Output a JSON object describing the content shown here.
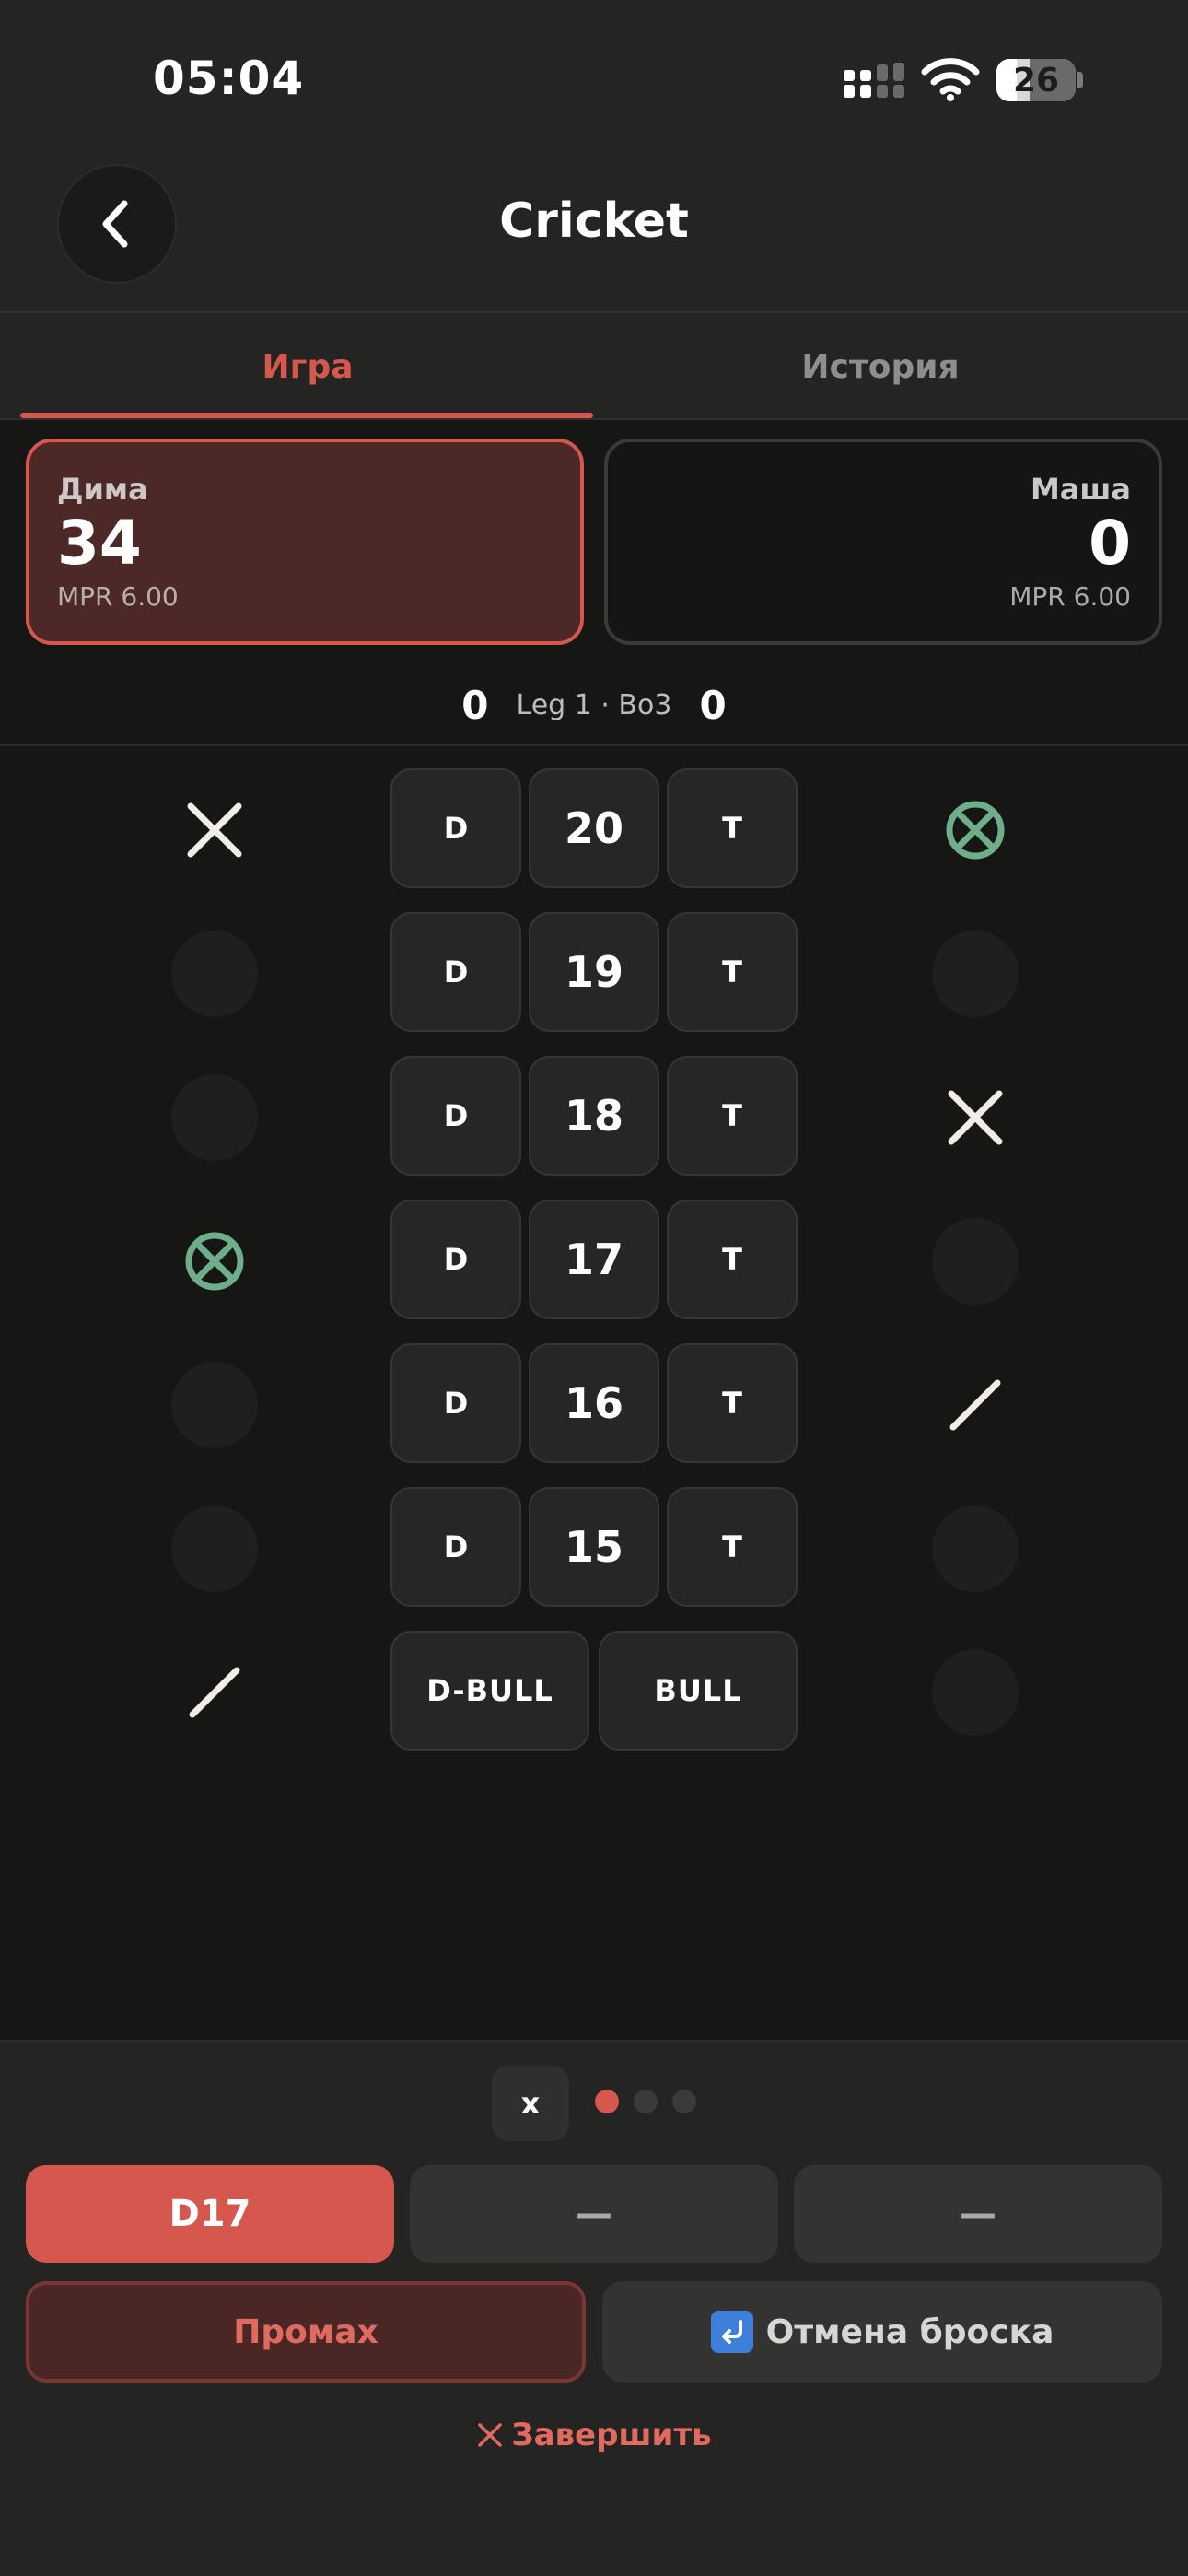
{
  "status_bar": {
    "time": "05:04",
    "battery": "26",
    "battery_level": 0.26
  },
  "header": {
    "title": "Cricket"
  },
  "tabs": [
    {
      "label": "Игра",
      "active": true
    },
    {
      "label": "История",
      "active": false
    }
  ],
  "players": [
    {
      "name": "Дима",
      "score": "34",
      "mpr": "MPR 6.00",
      "active": true
    },
    {
      "name": "Маша",
      "score": "0",
      "mpr": "MPR 6.00",
      "active": false
    }
  ],
  "leg": {
    "left_score": "0",
    "text": "Leg 1 · Bo3",
    "right_score": "0"
  },
  "board": {
    "rows": [
      {
        "double": "D",
        "number": "20",
        "triple": "T",
        "left_marks": 2,
        "right_marks": 3
      },
      {
        "double": "D",
        "number": "19",
        "triple": "T",
        "left_marks": 0,
        "right_marks": 0
      },
      {
        "double": "D",
        "number": "18",
        "triple": "T",
        "left_marks": 0,
        "right_marks": 2
      },
      {
        "double": "D",
        "number": "17",
        "triple": "T",
        "left_marks": 3,
        "right_marks": 0
      },
      {
        "double": "D",
        "number": "16",
        "triple": "T",
        "left_marks": 0,
        "right_marks": 1
      },
      {
        "double": "D",
        "number": "15",
        "triple": "T",
        "left_marks": 0,
        "right_marks": 0
      }
    ],
    "bull_row": {
      "double_bull": "D-BULL",
      "bull": "BULL",
      "left_marks": 1,
      "right_marks": 0
    }
  },
  "input": {
    "multiplier_label": "x",
    "page_dots": 3,
    "active_dot": 0,
    "darts": [
      "D17",
      "—",
      "—"
    ],
    "miss_label": "Промах",
    "undo_label": "Отмена броска",
    "finish_label": "Завершить"
  },
  "colors": {
    "accent": "#d6574e",
    "closed": "#6fae8a",
    "mark": "#f2ede6"
  },
  "icons": [
    "chevron-left-icon",
    "cellular-signal-icon",
    "wifi-icon",
    "battery-icon",
    "undo-arrow-icon",
    "close-icon"
  ]
}
